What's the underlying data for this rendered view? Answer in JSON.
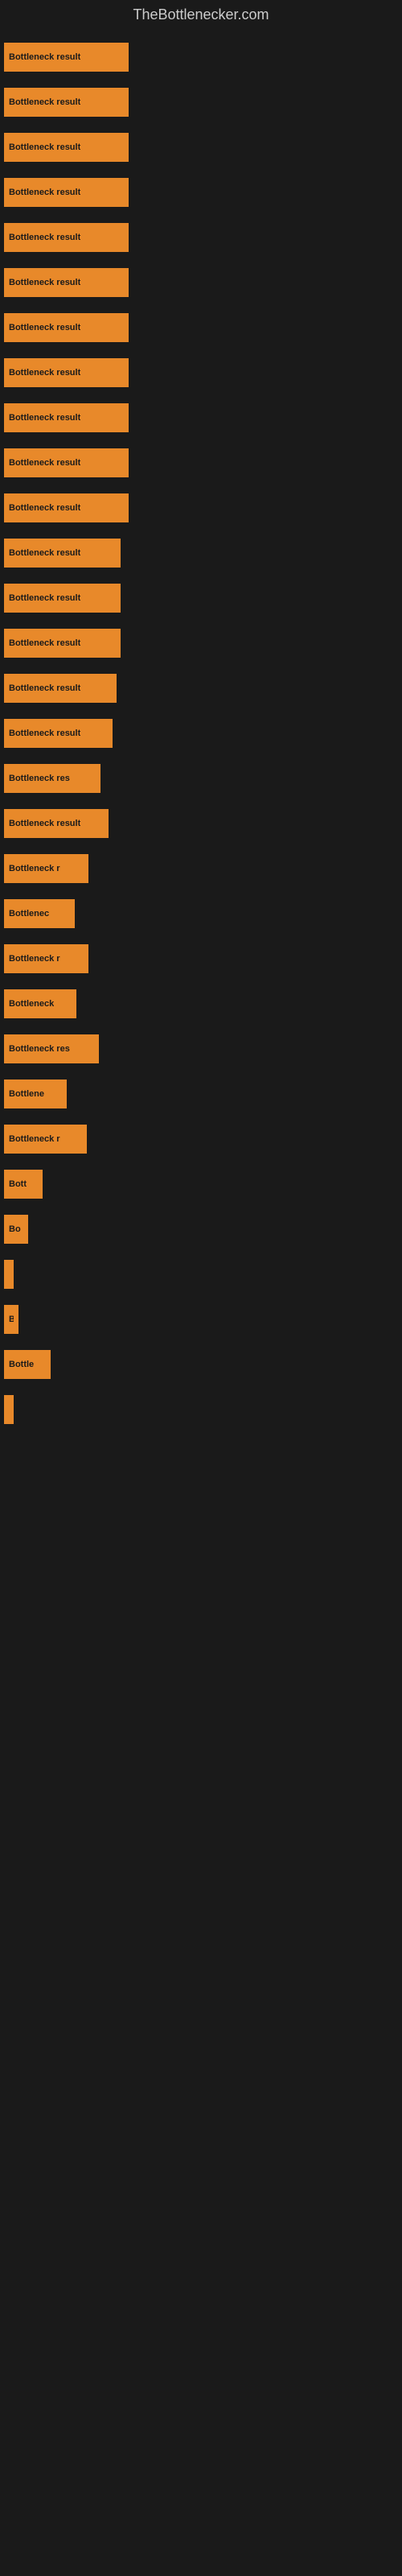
{
  "site": {
    "title": "TheBottlenecker.com"
  },
  "chart": {
    "bars": [
      {
        "label": "Bottleneck result",
        "width": 155,
        "truncated": false
      },
      {
        "label": "Bottleneck result",
        "width": 155,
        "truncated": false
      },
      {
        "label": "Bottleneck result",
        "width": 155,
        "truncated": false
      },
      {
        "label": "Bottleneck result",
        "width": 155,
        "truncated": false
      },
      {
        "label": "Bottleneck result",
        "width": 155,
        "truncated": false
      },
      {
        "label": "Bottleneck result",
        "width": 155,
        "truncated": false
      },
      {
        "label": "Bottleneck result",
        "width": 155,
        "truncated": false
      },
      {
        "label": "Bottleneck result",
        "width": 155,
        "truncated": false
      },
      {
        "label": "Bottleneck result",
        "width": 155,
        "truncated": false
      },
      {
        "label": "Bottleneck result",
        "width": 155,
        "truncated": false
      },
      {
        "label": "Bottleneck result",
        "width": 155,
        "truncated": false
      },
      {
        "label": "Bottleneck result",
        "width": 145,
        "truncated": false
      },
      {
        "label": "Bottleneck result",
        "width": 145,
        "truncated": false
      },
      {
        "label": "Bottleneck result",
        "width": 145,
        "truncated": false
      },
      {
        "label": "Bottleneck result",
        "width": 140,
        "truncated": false
      },
      {
        "label": "Bottleneck result",
        "width": 135,
        "truncated": false
      },
      {
        "label": "Bottleneck res",
        "width": 120,
        "truncated": true
      },
      {
        "label": "Bottleneck result",
        "width": 130,
        "truncated": false
      },
      {
        "label": "Bottleneck r",
        "width": 105,
        "truncated": true
      },
      {
        "label": "Bottlenec",
        "width": 88,
        "truncated": true
      },
      {
        "label": "Bottleneck r",
        "width": 105,
        "truncated": true
      },
      {
        "label": "Bottleneck",
        "width": 90,
        "truncated": true
      },
      {
        "label": "Bottleneck res",
        "width": 118,
        "truncated": true
      },
      {
        "label": "Bottlene",
        "width": 78,
        "truncated": true
      },
      {
        "label": "Bottleneck r",
        "width": 103,
        "truncated": true
      },
      {
        "label": "Bott",
        "width": 48,
        "truncated": true
      },
      {
        "label": "Bo",
        "width": 30,
        "truncated": true
      },
      {
        "label": "|",
        "width": 12,
        "truncated": true
      },
      {
        "label": "B",
        "width": 18,
        "truncated": true
      },
      {
        "label": "Bottle",
        "width": 58,
        "truncated": true
      },
      {
        "label": "|",
        "width": 12,
        "truncated": true
      }
    ]
  }
}
